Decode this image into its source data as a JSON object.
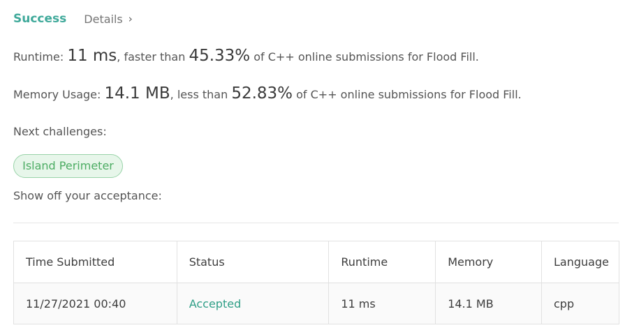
{
  "header": {
    "status": "Success",
    "details_label": "Details",
    "details_chevron": "›"
  },
  "runtime": {
    "label": "Runtime: ",
    "value": "11 ms",
    "mid": ", faster than ",
    "percent": "45.33%",
    "suffix": " of C++ online submissions for Flood Fill."
  },
  "memory": {
    "label": "Memory Usage: ",
    "value": "14.1 MB",
    "mid": ", less than ",
    "percent": "52.83%",
    "suffix": " of C++ online submissions for Flood Fill."
  },
  "next": {
    "label": "Next challenges:",
    "challenges": [
      "Island Perimeter"
    ]
  },
  "show_off": "Show off your acceptance:",
  "table": {
    "headers": [
      "Time Submitted",
      "Status",
      "Runtime",
      "Memory",
      "Language"
    ],
    "rows": [
      [
        "11/27/2021 00:40",
        "Accepted",
        "11 ms",
        "14.1 MB",
        "cpp"
      ]
    ]
  },
  "colors": {
    "success": "#3fa99a",
    "tag_border": "#98d3a8",
    "tag_bg": "#e7f6ea",
    "accepted": "#2e9e86"
  }
}
